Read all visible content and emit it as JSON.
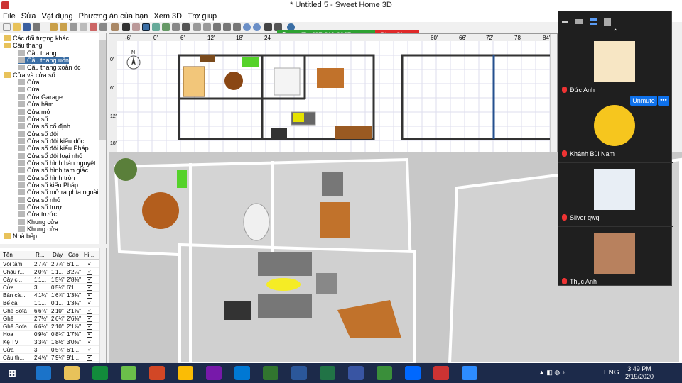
{
  "window": {
    "title": "* Untitled 5 - Sweet Home 3D"
  },
  "menu": [
    "File",
    "Sửa",
    "Vật dụng",
    "Phương án của bạn",
    "Xem 3D",
    "Trợ giúp"
  ],
  "share_bar": {
    "id_text": "ID: 497-311-9937",
    "stop_label": "Stop Share"
  },
  "catalog": {
    "items": [
      {
        "label": "Các đối tượng khác",
        "level": 1,
        "type": "folder"
      },
      {
        "label": "Cầu thang",
        "level": 1,
        "type": "folder"
      },
      {
        "label": "Cầu thang",
        "level": 2,
        "type": "item"
      },
      {
        "label": "Cầu thang uốn",
        "level": 2,
        "type": "item",
        "selected": true
      },
      {
        "label": "Cầu thang xoắn ốc",
        "level": 2,
        "type": "item"
      },
      {
        "label": "Cửa và cửa sổ",
        "level": 1,
        "type": "folder"
      },
      {
        "label": "Cửa",
        "level": 2,
        "type": "item"
      },
      {
        "label": "Cửa",
        "level": 2,
        "type": "item"
      },
      {
        "label": "Cửa Garage",
        "level": 2,
        "type": "item"
      },
      {
        "label": "Cửa hầm",
        "level": 2,
        "type": "item"
      },
      {
        "label": "Cửa mở",
        "level": 2,
        "type": "item"
      },
      {
        "label": "Cửa sổ",
        "level": 2,
        "type": "item"
      },
      {
        "label": "Cửa sổ cố định",
        "level": 2,
        "type": "item"
      },
      {
        "label": "Cửa sổ đôi",
        "level": 2,
        "type": "item"
      },
      {
        "label": "Cửa sổ đôi kiểu dốc",
        "level": 2,
        "type": "item"
      },
      {
        "label": "Cửa sổ đôi kiểu Pháp",
        "level": 2,
        "type": "item"
      },
      {
        "label": "Cửa sổ đôi loại nhỏ",
        "level": 2,
        "type": "item"
      },
      {
        "label": "Cửa sổ hình bán nguyệt",
        "level": 2,
        "type": "item"
      },
      {
        "label": "Cửa sổ hình tam giác",
        "level": 2,
        "type": "item"
      },
      {
        "label": "Cửa sổ hình tròn",
        "level": 2,
        "type": "item"
      },
      {
        "label": "Cửa sổ kiểu Pháp",
        "level": 2,
        "type": "item"
      },
      {
        "label": "Cửa sổ mở ra phía ngoài",
        "level": 2,
        "type": "item"
      },
      {
        "label": "Cửa sổ nhỏ",
        "level": 2,
        "type": "item"
      },
      {
        "label": "Cửa sổ trượt",
        "level": 2,
        "type": "item"
      },
      {
        "label": "Cửa trước",
        "level": 2,
        "type": "item"
      },
      {
        "label": "Khung cửa",
        "level": 2,
        "type": "item"
      },
      {
        "label": "Khung cửa",
        "level": 2,
        "type": "item"
      },
      {
        "label": "Nhà bếp",
        "level": 1,
        "type": "folder"
      }
    ]
  },
  "furniture": {
    "columns": [
      "Tên",
      "R...",
      "Dày",
      "Cao",
      "Hi..."
    ],
    "rows": [
      [
        "Vòi tắm",
        "2'7⅞\"",
        "2'7⅞\"",
        "6'1..."
      ],
      [
        "Chậu r...",
        "2'0⅜\"",
        "1'1...",
        "3'2¼\""
      ],
      [
        "Cây c...",
        "1'1...",
        "1'5⅜\"",
        "2'8¾\""
      ],
      [
        "Cửa",
        "3'",
        "0'5¾\"",
        "6'1..."
      ],
      [
        "Bàn cà...",
        "4'1¼\"",
        "1'6⅞\"",
        "1'3¾\""
      ],
      [
        "Bể cá",
        "1'1...",
        "0'1...",
        "1'3¾\""
      ],
      [
        "Ghế Sofa",
        "6'6¾\"",
        "2'10\"",
        "2'1⅞\""
      ],
      [
        "Ghế",
        "2'7½\"",
        "2'6¾\"",
        "2'6¾\""
      ],
      [
        "Ghế Sofa",
        "6'6¾\"",
        "2'10\"",
        "2'1⅞\""
      ],
      [
        "Hoa",
        "0'9½\"",
        "0'8¾\"",
        "1'7⅜\""
      ],
      [
        "Kệ TV",
        "3'3⅜\"",
        "1'8½\"",
        "3'0⅜\""
      ],
      [
        "Cửa",
        "3'",
        "0'5¾\"",
        "6'1..."
      ],
      [
        "Cầu th...",
        "2'4⅝\"",
        "7'9¾\"",
        "9'1..."
      ]
    ]
  },
  "plan": {
    "ruler_top": [
      "-6'",
      "0'",
      "6'",
      "12'",
      "18'",
      "24'",
      "60'",
      "66'",
      "72'",
      "78'",
      "84'"
    ],
    "ruler_left": [
      "0'",
      "6'",
      "12'",
      "18'"
    ],
    "compass": "N"
  },
  "zoom": {
    "participants": [
      {
        "name": "Đức Anh",
        "muted": true
      },
      {
        "name": "Khánh Bùi Nam",
        "muted": true
      },
      {
        "name": "Silver qwq",
        "muted": true
      },
      {
        "name": "Thục Anh",
        "muted": true
      }
    ],
    "unmute_label": "Unmute",
    "more_label": "•••"
  },
  "taskbar": {
    "apps": [
      "Internet Explorer",
      "File Explorer",
      "Store",
      "Windows Media",
      "PowerPoint",
      "Chrome",
      "OneNote",
      "Outlook",
      "Project",
      "Word",
      "Excel",
      "Visio",
      "Maps",
      "Zalo",
      "Sweet Home 3D",
      "Zoom"
    ],
    "lang": "ENG",
    "time": "3:49 PM",
    "date": "2/19/2020"
  },
  "colors": {
    "accent": "#3a6ea5",
    "zoom_bg": "#1f1f1f",
    "share_green": "#2da131",
    "stop_red": "#e02828",
    "zoom_blue": "#0e71eb",
    "taskbar": "#1c2a4a",
    "wood": "#c1722b"
  }
}
